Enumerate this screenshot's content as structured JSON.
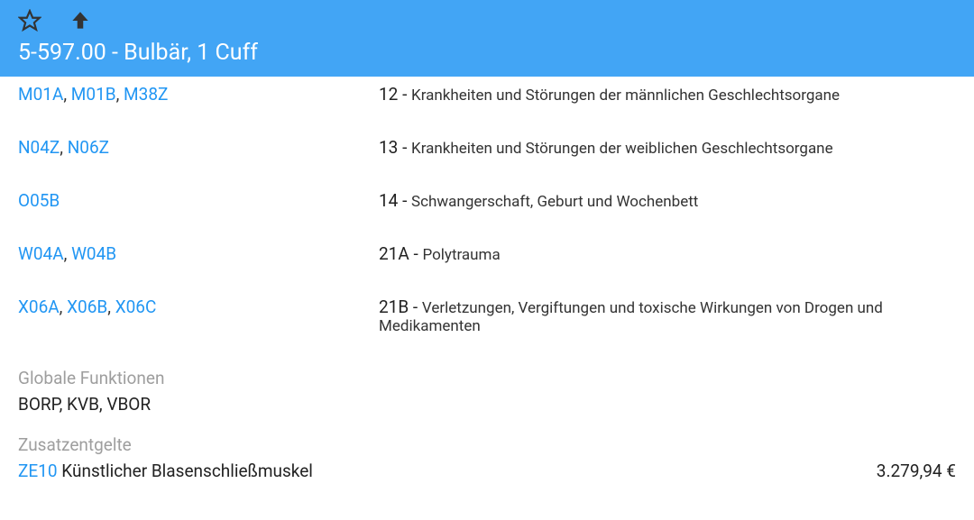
{
  "header": {
    "title": "5-597.00 - Bulbär, 1 Cuff"
  },
  "rows": [
    {
      "codes": [
        "M01A",
        "M01B",
        "M38Z"
      ],
      "num": "12",
      "desc": "Krankheiten und Störungen der männlichen Geschlechtsorgane"
    },
    {
      "codes": [
        "N04Z",
        "N06Z"
      ],
      "num": "13",
      "desc": "Krankheiten und Störungen der weiblichen Geschlechtsorgane"
    },
    {
      "codes": [
        "O05B"
      ],
      "num": "14",
      "desc": "Schwangerschaft, Geburt und Wochenbett"
    },
    {
      "codes": [
        "W04A",
        "W04B"
      ],
      "num": "21A",
      "desc": "Polytrauma"
    },
    {
      "codes": [
        "X06A",
        "X06B",
        "X06C"
      ],
      "num": "21B",
      "desc": "Verletzungen, Vergiftungen und toxische Wirkungen von Drogen und Medikamenten"
    }
  ],
  "globalFunctions": {
    "label": "Globale Funktionen",
    "text": "BORP, KVB, VBOR"
  },
  "zusatz": {
    "label": "Zusatzentgelte",
    "code": "ZE10",
    "desc": "Künstlicher Blasenschließmuskel",
    "price": "3.279,94 €"
  }
}
